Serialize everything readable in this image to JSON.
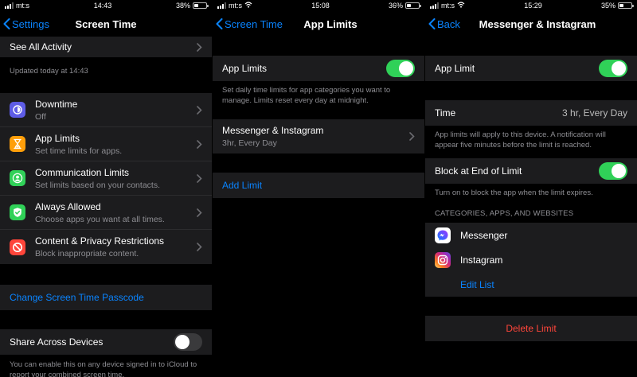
{
  "screen1": {
    "status": {
      "carrier": "mt:s",
      "time": "14:43",
      "battery": "38%",
      "battery_level": 0.38
    },
    "nav": {
      "back": "Settings",
      "title": "Screen Time"
    },
    "see_all": "See All Activity",
    "updated": "Updated today at 14:43",
    "items": [
      {
        "title": "Downtime",
        "subtitle": "Off",
        "icon": "downtime-icon",
        "color": "#5e5ce6"
      },
      {
        "title": "App Limits",
        "subtitle": "Set time limits for apps.",
        "icon": "hourglass-icon",
        "color": "#ff9f0a"
      },
      {
        "title": "Communication Limits",
        "subtitle": "Set limits based on your contacts.",
        "icon": "person-icon",
        "color": "#30d158"
      },
      {
        "title": "Always Allowed",
        "subtitle": "Choose apps you want at all times.",
        "icon": "checkmark-icon",
        "color": "#30d158"
      },
      {
        "title": "Content & Privacy Restrictions",
        "subtitle": "Block inappropriate content.",
        "icon": "restriction-icon",
        "color": "#ff453a"
      }
    ],
    "passcode": "Change Screen Time Passcode",
    "share": {
      "label": "Share Across Devices",
      "on": false
    },
    "share_caption": "You can enable this on any device signed in to iCloud to report your combined screen time."
  },
  "screen2": {
    "status": {
      "carrier": "mt:s",
      "time": "15:08",
      "battery": "36%",
      "battery_level": 0.36
    },
    "nav": {
      "back": "Screen Time",
      "title": "App Limits"
    },
    "app_limits": {
      "label": "App Limits",
      "on": true
    },
    "caption": "Set daily time limits for app categories you want to manage. Limits reset every day at midnight.",
    "limit": {
      "title": "Messenger & Instagram",
      "subtitle": "3hr, Every Day"
    },
    "add_limit": "Add Limit"
  },
  "screen3": {
    "status": {
      "carrier": "mt:s",
      "time": "15:29",
      "battery": "35%",
      "battery_level": 0.35
    },
    "nav": {
      "back": "Back",
      "title": "Messenger & Instagram"
    },
    "app_limit": {
      "label": "App Limit",
      "on": true
    },
    "time": {
      "label": "Time",
      "value": "3 hr, Every Day"
    },
    "time_caption": "App limits will apply to this device. A notification will appear five minutes before the limit is reached.",
    "block": {
      "label": "Block at End of Limit",
      "on": true
    },
    "block_caption": "Turn on to block the app when the limit expires.",
    "section_label": "CATEGORIES, APPS, AND WEBSITES",
    "apps": [
      {
        "name": "Messenger",
        "icon": "messenger-icon"
      },
      {
        "name": "Instagram",
        "icon": "instagram-icon"
      }
    ],
    "edit_list": "Edit List",
    "delete": "Delete Limit"
  }
}
